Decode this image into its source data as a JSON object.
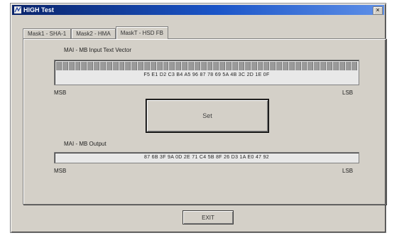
{
  "window": {
    "title": "HIGH Test",
    "close_glyph": "×"
  },
  "tabs": [
    {
      "label": "Mask1 - SHA-1"
    },
    {
      "label": "Mask2 - HMA"
    },
    {
      "label": "MaskT - HSD FB"
    }
  ],
  "active_tab": 2,
  "input_section": {
    "label": "MAI - MB Input Text Vector",
    "hex_value": "F5 E1 D2 C3 B4 A5 96 87 78 69 5A 4B 3C 2D 1E 0F",
    "msb_label": "MSB",
    "lsb_label": "LSB"
  },
  "set_button": {
    "label": "Set"
  },
  "output_section": {
    "label": "MAI - MB Output",
    "hex_value": "87 6B 3F 9A 0D 2E 71 C4 5B 8F 26 D3 1A E0 47 92",
    "msb_label": "MSB",
    "lsb_label": "LSB"
  },
  "exit_button": {
    "label": "EXIT"
  },
  "icons": {
    "app": "app-icon",
    "close": "close-icon"
  },
  "colors": {
    "titlebar": "#0a246a",
    "face": "#d4d0c8"
  }
}
